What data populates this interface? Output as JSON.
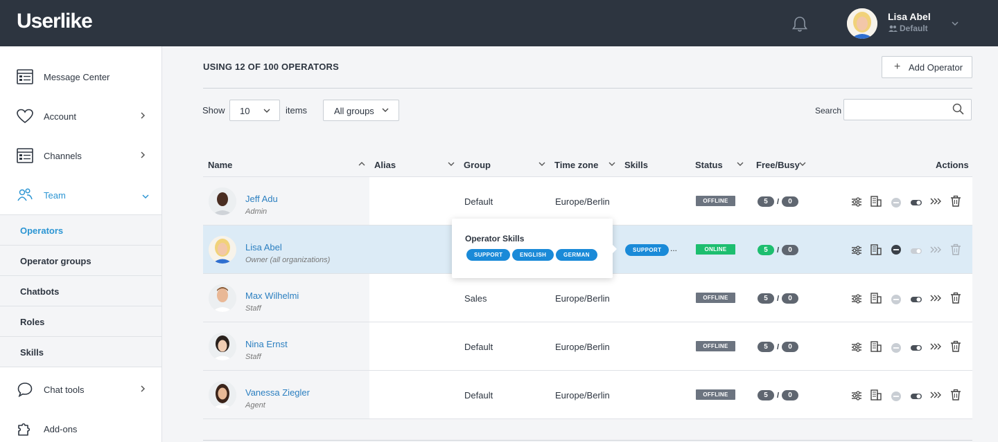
{
  "app": {
    "logo": "Userlike"
  },
  "user": {
    "name": "Lisa Abel",
    "group": "Default"
  },
  "sidebar": {
    "items": [
      {
        "label": "Message Center"
      },
      {
        "label": "Account"
      },
      {
        "label": "Channels"
      },
      {
        "label": "Team"
      },
      {
        "label": "Chat tools"
      },
      {
        "label": "Add-ons"
      }
    ],
    "team_sub": [
      {
        "label": "Operators"
      },
      {
        "label": "Operator groups"
      },
      {
        "label": "Chatbots"
      },
      {
        "label": "Roles"
      },
      {
        "label": "Skills"
      }
    ]
  },
  "main": {
    "usage": "USING 12 OF 100 OPERATORS",
    "add_label": "Add Operator",
    "show_label": "Show",
    "page_size": "10",
    "items_label": "items",
    "group_filter": "All groups",
    "search_label": "Search",
    "search_placeholder": ""
  },
  "table": {
    "headers": {
      "name": "Name",
      "alias": "Alias",
      "group": "Group",
      "timezone": "Time zone",
      "skills": "Skills",
      "status": "Status",
      "freebusy": "Free/Busy",
      "actions": "Actions"
    },
    "rows": [
      {
        "name": "Jeff Adu",
        "role": "Admin",
        "group": "Default",
        "timezone": "Europe/Berlin",
        "status": "OFFLINE",
        "free": "5",
        "busy": "0"
      },
      {
        "name": "Lisa Abel",
        "role": "Owner (all organizations)",
        "group": "",
        "timezone": "",
        "status": "ONLINE",
        "free": "5",
        "busy": "0",
        "skill": "SUPPORT",
        "more": "..."
      },
      {
        "name": "Max Wilhelmi",
        "role": "Staff",
        "group": "Sales",
        "timezone": "Europe/Berlin",
        "status": "OFFLINE",
        "free": "5",
        "busy": "0"
      },
      {
        "name": "Nina Ernst",
        "role": "Staff",
        "group": "Default",
        "timezone": "Europe/Berlin",
        "status": "OFFLINE",
        "free": "5",
        "busy": "0"
      },
      {
        "name": "Vanessa Ziegler",
        "role": "Agent",
        "group": "Default",
        "timezone": "Europe/Berlin",
        "status": "OFFLINE",
        "free": "5",
        "busy": "0"
      }
    ],
    "slash": "/"
  },
  "popover": {
    "title": "Operator Skills",
    "tags": [
      "SUPPORT",
      "ENGLISH",
      "GERMAN"
    ]
  },
  "colors": {
    "topbar": "#2d3540",
    "accent": "#2b95d3",
    "online": "#1dbe6f",
    "offline": "#6c7480",
    "skill": "#1a8ad8"
  }
}
